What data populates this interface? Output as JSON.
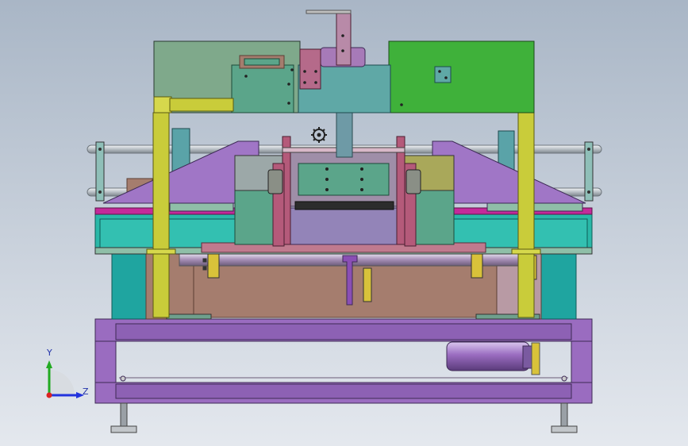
{
  "viewport": {
    "background_top": "#a9b6c6",
    "background_bottom": "#e4e8ee"
  },
  "triad": {
    "y_label": "Y",
    "z_label": "Z",
    "y_color": "#22aa22",
    "z_color": "#2233dd",
    "x_color": "#dd2222"
  },
  "colors": {
    "purple_frame": "#9a6cc0",
    "purple_dark": "#6f4a92",
    "olive": "#c9cc3a",
    "green_panel": "#7fa98b",
    "bright_green": "#3fb13a",
    "teal": "#1fa5a0",
    "teal_light": "#2ab8a8",
    "brown_tan": "#a57d6e",
    "rose": "#c07a8e",
    "violet_plate": "#a076c6",
    "magenta": "#c42a9a",
    "steel": "#b9bfc4",
    "mid_blue": "#5aa3a8"
  }
}
